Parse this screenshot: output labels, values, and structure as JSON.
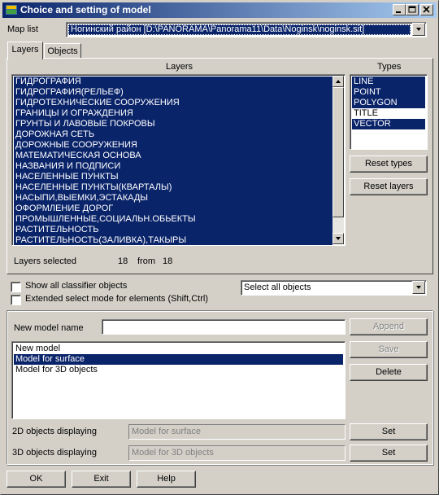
{
  "window": {
    "title": "Choice and setting of model",
    "minimize_icon": "minimize-icon",
    "maximize_icon": "maximize-icon",
    "close_icon": "close-icon"
  },
  "map_list": {
    "label": "Map list",
    "value": "Ногинский район [D:\\PANORAMA\\Panorama11\\Data\\Noginsk\\noginsk.sit]"
  },
  "tabs": [
    {
      "label": "Layers",
      "active": true
    },
    {
      "label": "Objects",
      "active": false
    }
  ],
  "layers": {
    "header": "Layers",
    "items": [
      "ГИДРОГРАФИЯ",
      "ГИДРОГРАФИЯ(РЕЛЬЕФ)",
      "ГИДРОТЕХНИЧЕСКИЕ СООРУЖЕНИЯ",
      "ГРАНИЦЫ И ОГРАЖДЕНИЯ",
      "ГРУНТЫ И ЛАВОВЫЕ ПОКРОВЫ",
      "ДОРОЖНАЯ СЕТЬ",
      "ДОРОЖНЫЕ СООРУЖЕНИЯ",
      "МАТЕМАТИЧЕСКАЯ ОСНОВА",
      "НАЗВАНИЯ И ПОДПИСИ",
      "НАСЕЛЕННЫЕ ПУНКТЫ",
      "НАСЕЛЕННЫЕ ПУНКТЫ(КВАРТАЛЫ)",
      "НАСЫПИ,ВЫЕМКИ,ЭСТАКАДЫ",
      "ОФОРМЛЕНИЕ ДОРОГ",
      "ПРОМЫШЛЕННЫЕ,СОЦИАЛЬН.ОБЬЕКТЫ",
      "РАСТИТЕЛЬНОСТЬ",
      "РАСТИТЕЛЬНОСТЬ(ЗАЛИВКА),ТАКЫРЫ"
    ],
    "selected_label": "Layers selected",
    "selected_count": "18",
    "from_label": "from",
    "total_count": "18"
  },
  "types": {
    "header": "Types",
    "items": [
      {
        "label": "LINE",
        "selected": true
      },
      {
        "label": "POINT",
        "selected": true
      },
      {
        "label": "POLYGON",
        "selected": true
      },
      {
        "label": "TITLE",
        "selected": false
      },
      {
        "label": "VECTOR",
        "selected": true
      }
    ]
  },
  "buttons": {
    "reset_types": "Reset types",
    "reset_layers": "Reset layers",
    "append": "Append",
    "save": "Save",
    "delete": "Delete",
    "set_2d": "Set",
    "set_3d": "Set",
    "ok": "OK",
    "exit": "Exit",
    "help": "Help"
  },
  "options": {
    "show_all": "Show all classifier objects",
    "extended_select": "Extended select mode for elements (Shift,Ctrl)",
    "select_dropdown": "Select all objects"
  },
  "model": {
    "name_label": "New model name",
    "name_value": "",
    "list": [
      {
        "label": "New model",
        "selected": false
      },
      {
        "label": "Model for surface",
        "selected": true
      },
      {
        "label": "Model for 3D objects",
        "selected": false
      }
    ],
    "display_2d_label": "2D objects displaying",
    "display_2d_value": "Model for surface",
    "display_3d_label": "3D objects displaying",
    "display_3d_value": "Model for 3D objects"
  },
  "colors": {
    "selection": "#0a246a",
    "face": "#d4d0c8"
  }
}
